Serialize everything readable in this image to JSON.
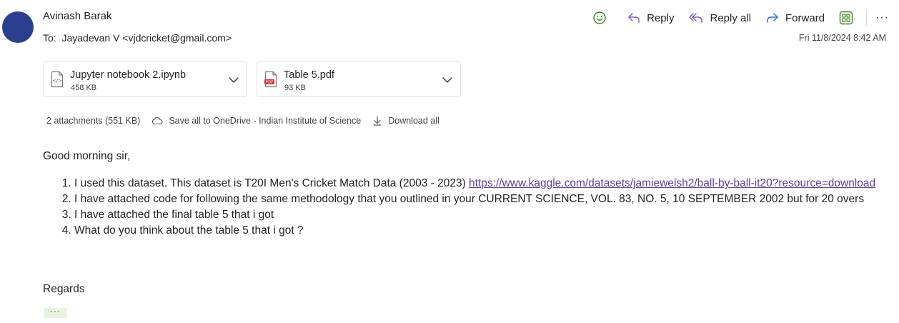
{
  "sender": {
    "name": "Avinash Barak"
  },
  "recipients": {
    "label": "To:",
    "value": "Jayadevan V <vjdcricket@gmail.com>"
  },
  "actions": {
    "reply": "Reply",
    "reply_all": "Reply all",
    "forward": "Forward",
    "more": "···"
  },
  "timestamp": "Fri 11/8/2024 8:42 AM",
  "attachments": [
    {
      "name": "Jupyter notebook 2.ipynb",
      "size": "458 KB"
    },
    {
      "name": "Table 5.pdf",
      "size": "93 KB"
    }
  ],
  "attachment_bar": {
    "summary": "2 attachments (551 KB)",
    "save_all": "Save all to OneDrive - Indian Institute of Science",
    "download_all": "Download all"
  },
  "message": {
    "greeting": "Good morning sir,",
    "items": [
      {
        "text": "I used this dataset. This dataset is T20I Men's Cricket Match Data (2003 - 2023) ",
        "link": "https://www.kaggle.com/datasets/jamiewelsh2/ball-by-ball-it20?resource=download"
      },
      {
        "text": "I have attached code for following the same methodology that you outlined in your CURRENT SCIENCE, VOL. 83, NO. 5, 10 SEPTEMBER 2002 but for 20 overs"
      },
      {
        "text": "I have attached the final table 5 that i got"
      },
      {
        "text": "What do you think about the table 5 that i got ?"
      }
    ],
    "closing": "Regards",
    "expand": "···"
  }
}
